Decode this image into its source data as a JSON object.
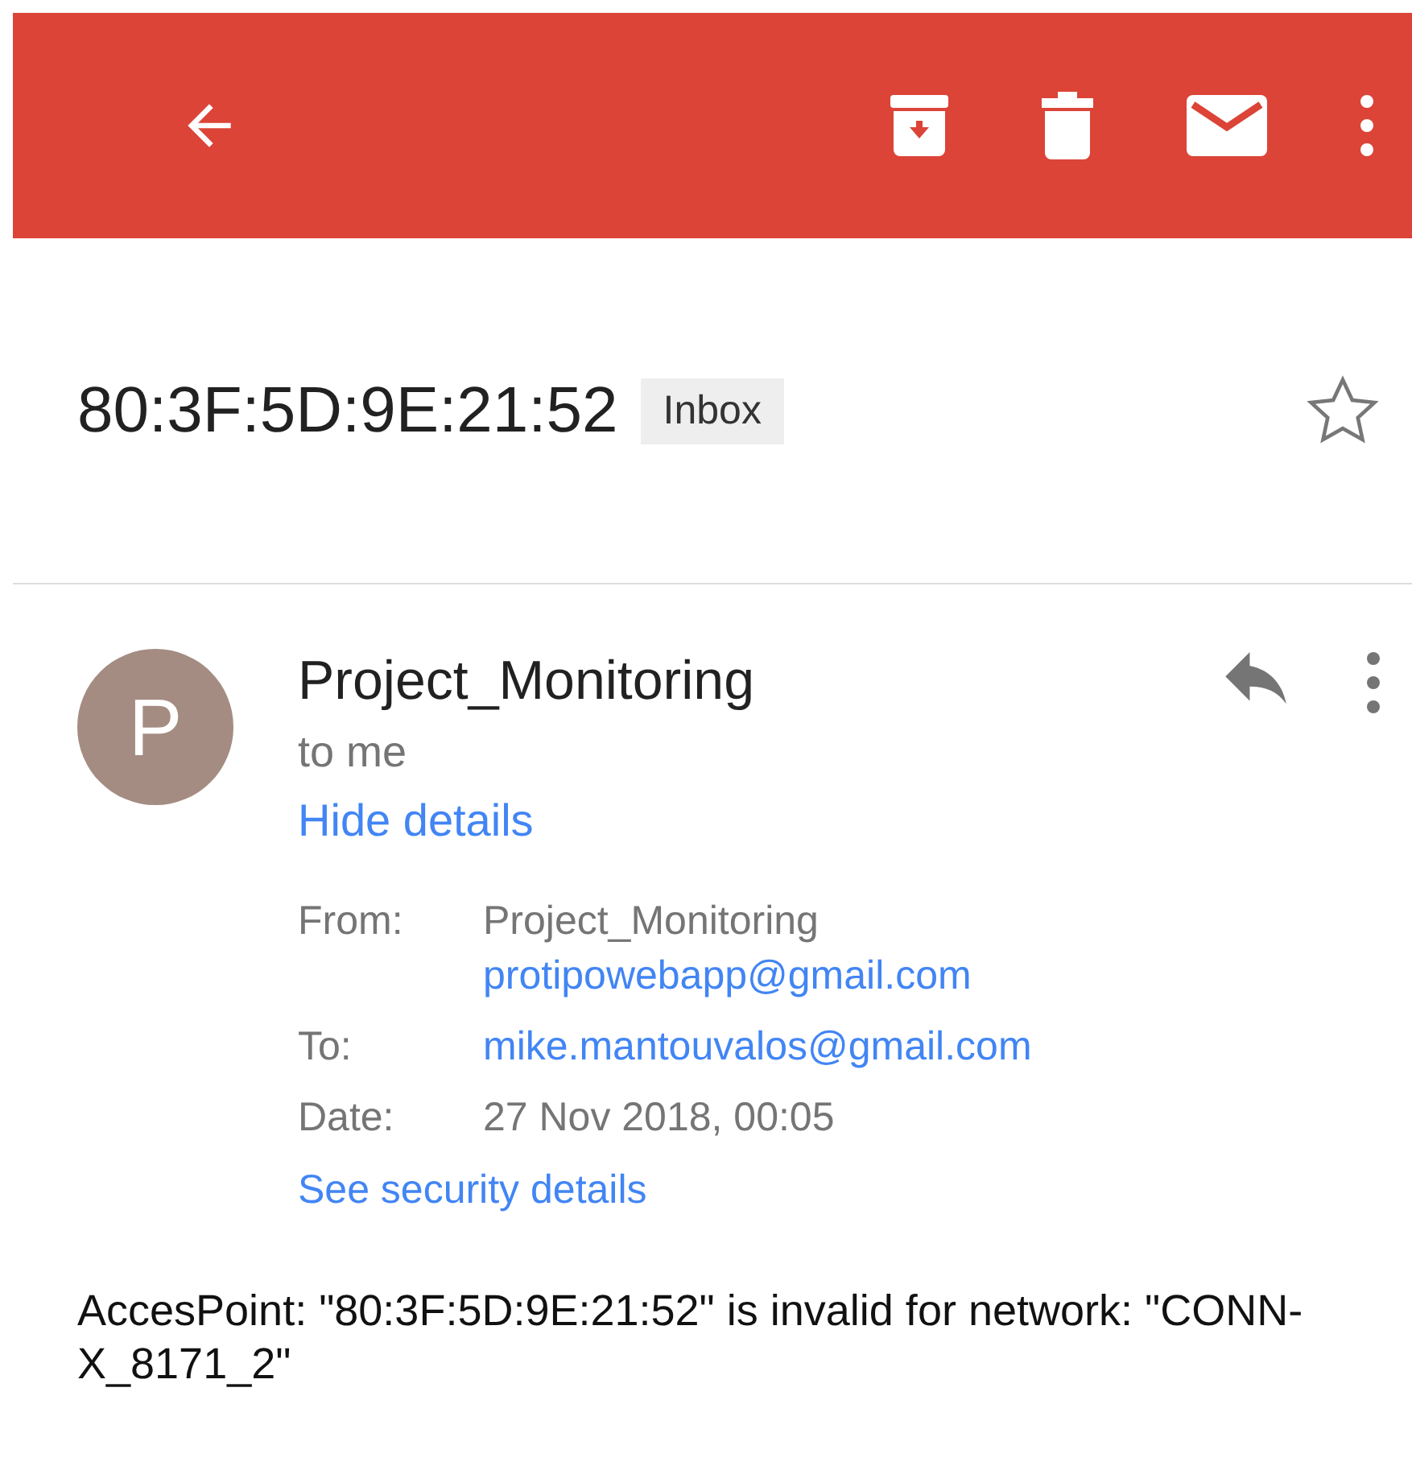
{
  "subject": "80:3F:5D:9E:21:52",
  "label": "Inbox",
  "starred": false,
  "sender": {
    "initial": "P",
    "name": "Project_Monitoring",
    "recipient_line": "to me",
    "details_link": "Hide details"
  },
  "details": [
    {
      "label": "From:",
      "values": [
        {
          "text": "Project_Monitoring",
          "kind": "plain"
        },
        {
          "text": "protipowebapp@gmail.com",
          "kind": "link"
        }
      ]
    },
    {
      "label": "To:",
      "values": [
        {
          "text": "mike.mantouvalos@gmail.com",
          "kind": "link"
        }
      ]
    },
    {
      "label": "Date:",
      "values": [
        {
          "text": "27 Nov 2018, 00:05",
          "kind": "plain"
        }
      ]
    }
  ],
  "security_link": "See security details",
  "body": "AccesPoint: \"80:3F:5D:9E:21:52\" is invalid for network: \"CONN-X_8171_2\""
}
